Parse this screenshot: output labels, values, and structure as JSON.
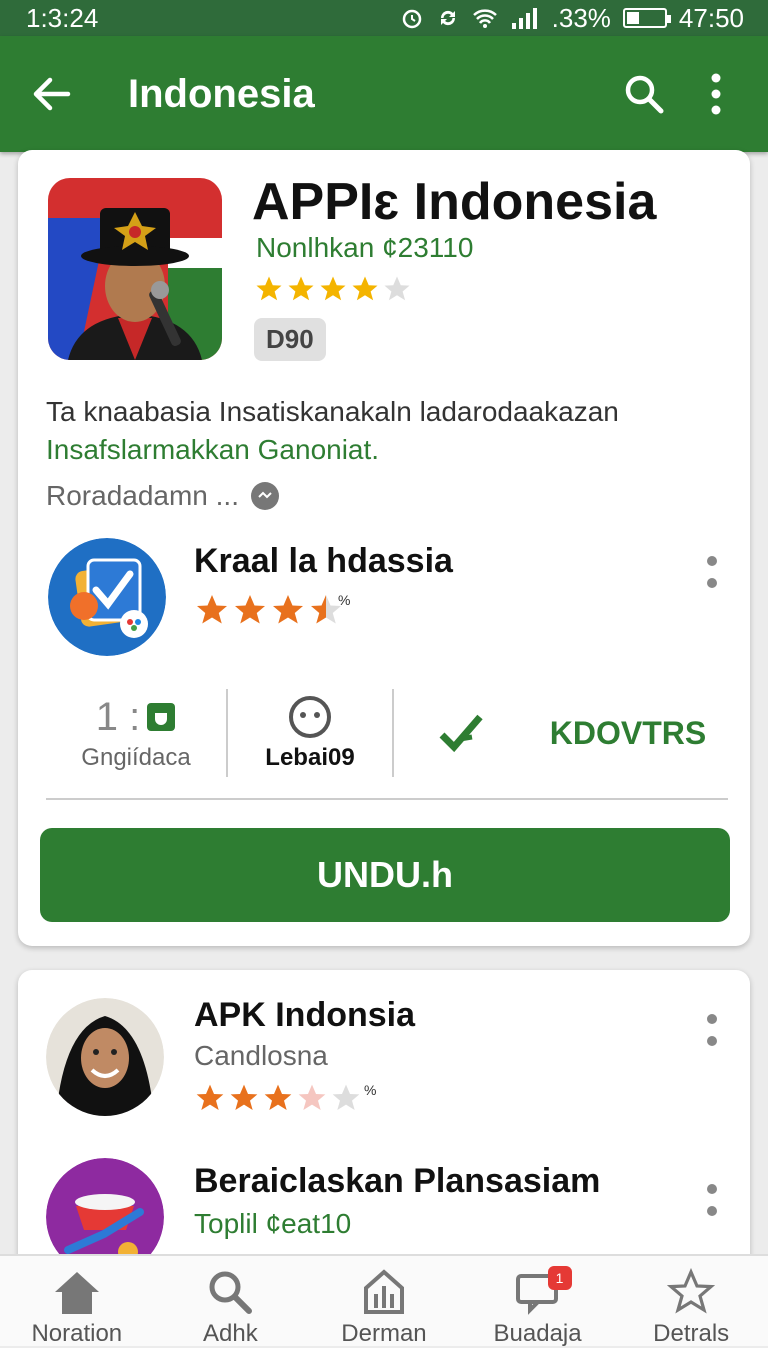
{
  "status_bar": {
    "time": "1:3:24",
    "battery": ".33%",
    "clock_right": "47:50",
    "icons": [
      "alarm-icon",
      "sync-icon",
      "wifi-icon",
      "signal-icon",
      "battery-icon"
    ]
  },
  "app_bar": {
    "title": "Indonesia",
    "back_icon": "arrow-left-icon",
    "search_icon": "search-icon",
    "more_icon": "more-vert-icon"
  },
  "featured": {
    "title": "APPIɛ Indonesia",
    "subtitle": "Nonlhkan ¢23110",
    "rating": 4,
    "badge": "D90",
    "description_line1": "Ta knaabasia Insatiskanakaln ladarodaakazan",
    "description_line2": "Insafslarmakkan Ganoniat.",
    "more_link": "Roradadamn ...",
    "related": {
      "title": "Kraal la hdassia",
      "rating": 3.5,
      "rating_suffix": "%"
    },
    "stats": [
      {
        "value": "1 :",
        "label": "Gngiídaca"
      },
      {
        "value": "",
        "label": "Lebai09"
      },
      {
        "value": "",
        "label": "KDOVTRS"
      }
    ],
    "install_label": "UNDU.h"
  },
  "list": [
    {
      "title": "APK Indonsia",
      "subtitle": "Candlosna",
      "rating": 3,
      "rating_suffix": "%"
    },
    {
      "title": "Beraiclaskan Plansasiam",
      "subtitle": "Toplil ¢eat10"
    }
  ],
  "bottom_nav": [
    {
      "label": "Noration",
      "icon": "home-icon"
    },
    {
      "label": "Adhk",
      "icon": "search-icon"
    },
    {
      "label": "Derman",
      "icon": "apps-icon"
    },
    {
      "label": "Buadaja",
      "icon": "notifications-icon",
      "badge": "1"
    },
    {
      "label": "Detrals",
      "icon": "star-icon"
    }
  ],
  "colors": {
    "primary": "#2e7d32",
    "status_bar": "#2f6b3a",
    "star": "#f4b400",
    "star_orange": "#e8711d"
  }
}
